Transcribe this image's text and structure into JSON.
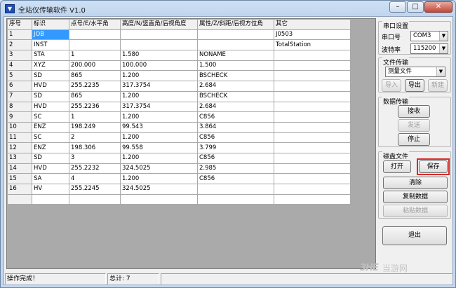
{
  "window": {
    "title": "全站仪传输软件  V1.0",
    "controls": {
      "minimize": "–",
      "maximize": "□",
      "close": "✕"
    }
  },
  "grid": {
    "headers": [
      "序号",
      "标识",
      "点号/E/水平角",
      "高度/N/竖直角/后视角度",
      "属性/Z/斜距/后视方位角",
      "其它"
    ],
    "rows": [
      [
        "1",
        "JOB",
        "",
        "",
        "",
        "J0503"
      ],
      [
        "2",
        "INST",
        "",
        "",
        "",
        "TotalStation"
      ],
      [
        "3",
        "STA",
        "1",
        "1.580",
        "NONAME",
        ""
      ],
      [
        "4",
        "XYZ",
        "200.000",
        "100.000",
        "1.500",
        ""
      ],
      [
        "5",
        "SD",
        "865",
        "1.200",
        "BSCHECK",
        ""
      ],
      [
        "6",
        "HVD",
        "255.2235",
        "317.3754",
        "2.684",
        ""
      ],
      [
        "7",
        "SD",
        "865",
        "1.200",
        "BSCHECK",
        ""
      ],
      [
        "8",
        "HVD",
        "255.2236",
        "317.3754",
        "2.684",
        ""
      ],
      [
        "9",
        "SC",
        "1",
        "1.200",
        "C856",
        ""
      ],
      [
        "10",
        "ENZ",
        "198.249",
        "99.543",
        "3.864",
        ""
      ],
      [
        "11",
        "SC",
        "2",
        "1.200",
        "C856",
        ""
      ],
      [
        "12",
        "ENZ",
        "198.306",
        "99.558",
        "3.799",
        ""
      ],
      [
        "13",
        "SD",
        "3",
        "1.200",
        "C856",
        ""
      ],
      [
        "14",
        "HVD",
        "255.2232",
        "324.5025",
        "2.985",
        ""
      ],
      [
        "15",
        "SA",
        "4",
        "1.200",
        "C856",
        ""
      ],
      [
        "16",
        "HV",
        "255.2245",
        "324.5025",
        "",
        ""
      ]
    ]
  },
  "panel": {
    "serial": {
      "title": "串口设置",
      "port_label": "串口号",
      "port_value": "COM3",
      "baud_label": "波特率",
      "baud_value": "115200"
    },
    "file_transfer": {
      "title": "文件传输",
      "type_value": "测量文件",
      "import": "导入",
      "export": "导出",
      "new": "新建"
    },
    "data_transfer": {
      "title": "数据传输",
      "receive": "接收",
      "send": "发送",
      "stop": "停止"
    },
    "disk": {
      "title": "磁盘文件",
      "open": "打开",
      "save": "保存",
      "clear": "清除",
      "copy": "复制数据",
      "paste": "粘贴数据"
    },
    "exit": "退出"
  },
  "status": {
    "left": "操作完成！",
    "total": "总计: 7"
  },
  "watermark": {
    "logo": "3HE",
    "text": "当游网"
  }
}
